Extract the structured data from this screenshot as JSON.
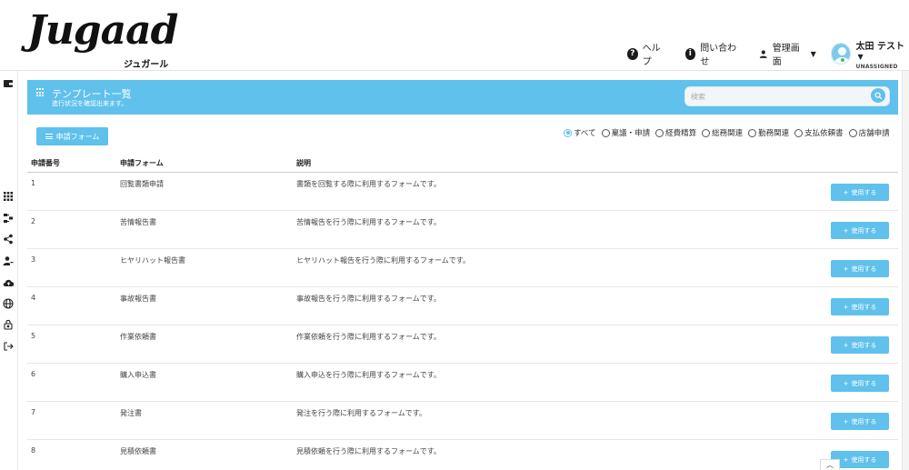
{
  "logo": {
    "main": "Jugaad",
    "sub": "ジュガール"
  },
  "nav": {
    "help": "ヘルプ",
    "contact": "問い合わせ",
    "admin": "管理画面",
    "user_name": "太田 テスト",
    "user_status": "UNASSIGNED"
  },
  "left_icons": [
    "wallet-icon",
    "apps-grid-icon",
    "flow-icon",
    "share-icon",
    "user-edit-icon",
    "cloud-upload-icon",
    "globe-icon",
    "lock-icon",
    "logout-icon"
  ],
  "panel": {
    "title": "テンプレート一覧",
    "subtitle": "進行状況を確認出来ます。",
    "search_placeholder": "検索"
  },
  "form_button": "申請フォーム",
  "filters": [
    {
      "label": "すべて",
      "checked": true
    },
    {
      "label": "稟議・申請",
      "checked": false
    },
    {
      "label": "経費精算",
      "checked": false
    },
    {
      "label": "総務関連",
      "checked": false
    },
    {
      "label": "勤務関連",
      "checked": false
    },
    {
      "label": "支払依頼書",
      "checked": false
    },
    {
      "label": "店舗申請",
      "checked": false
    }
  ],
  "table": {
    "headers": {
      "number": "申請番号",
      "form": "申請フォーム",
      "description": "説明"
    },
    "use_label": "使用する",
    "rows": [
      {
        "number": "1",
        "form": "回覧書類申請",
        "description": "書類を回覧する際に利用するフォームです。"
      },
      {
        "number": "2",
        "form": "苦情報告書",
        "description": "苦情報告を行う際に利用するフォームです。"
      },
      {
        "number": "3",
        "form": "ヒヤリハット報告書",
        "description": "ヒヤリハット報告を行う際に利用するフォームです。"
      },
      {
        "number": "4",
        "form": "事故報告書",
        "description": "事故報告を行う際に利用するフォームです。"
      },
      {
        "number": "5",
        "form": "作業依頼書",
        "description": "作業依頼を行う際に利用するフォームです。"
      },
      {
        "number": "6",
        "form": "購入申込書",
        "description": "購入申込を行う際に利用するフォームです。"
      },
      {
        "number": "7",
        "form": "発注書",
        "description": "発注を行う際に利用するフォームです。"
      },
      {
        "number": "8",
        "form": "見積依頼書",
        "description": "見積依頼を行う際に利用するフォームです。"
      }
    ]
  },
  "colors": {
    "accent": "#5fc1ec",
    "online": "#3cc46d"
  }
}
